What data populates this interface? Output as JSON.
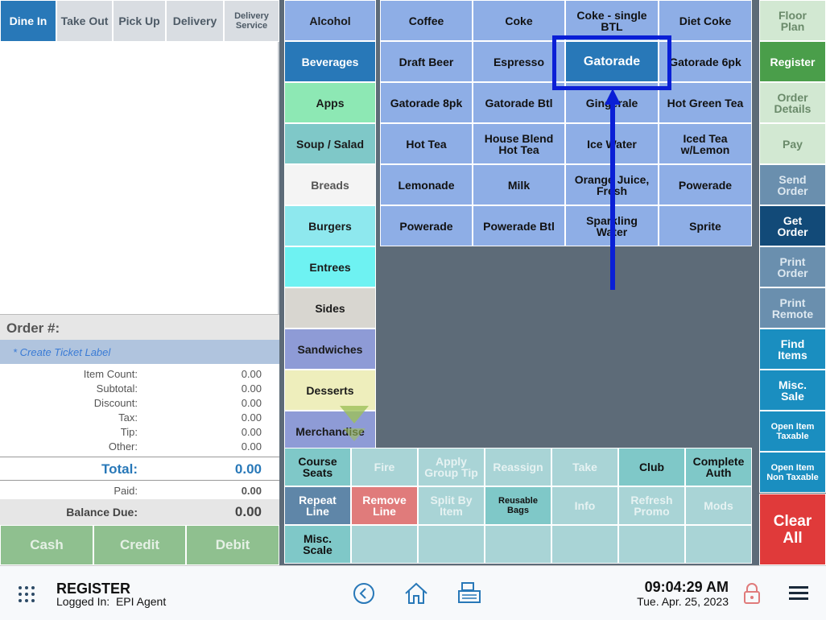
{
  "order_types": [
    {
      "label": "Dine In",
      "active": true
    },
    {
      "label": "Take Out",
      "active": false
    },
    {
      "label": "Pick Up",
      "active": false
    },
    {
      "label": "Delivery",
      "active": false
    },
    {
      "label": "Delivery Service",
      "active": false
    }
  ],
  "order": {
    "order_label": "Order #:",
    "create_ticket_label": "* Create Ticket Label",
    "totals": [
      {
        "label": "Item Count:",
        "value": "0.00"
      },
      {
        "label": "Subtotal:",
        "value": "0.00"
      },
      {
        "label": "Discount:",
        "value": "0.00"
      },
      {
        "label": "Tax:",
        "value": "0.00"
      },
      {
        "label": "Tip:",
        "value": "0.00"
      },
      {
        "label": "Other:",
        "value": "0.00"
      }
    ],
    "total_label": "Total:",
    "total_value": "0.00",
    "paid_label": "Paid:",
    "paid_value": "0.00",
    "balance_label": "Balance Due:",
    "balance_value": "0.00"
  },
  "payment_buttons": [
    "Cash",
    "Credit",
    "Debit"
  ],
  "categories": [
    {
      "label": "Alcohol",
      "color": "#8eaee6"
    },
    {
      "label": "Beverages",
      "color": "#2878b8",
      "selected": true
    },
    {
      "label": "Apps",
      "color": "#8de8b4"
    },
    {
      "label": "Soup / Salad",
      "color": "#7fc8c8"
    },
    {
      "label": "Breads",
      "color": "#f4f4f4"
    },
    {
      "label": "Burgers",
      "color": "#8ee8ee"
    },
    {
      "label": "Entrees",
      "color": "#6ef2f2"
    },
    {
      "label": "Sides",
      "color": "#d8d6d0"
    },
    {
      "label": "Sandwiches",
      "color": "#8e9bd6"
    },
    {
      "label": "Desserts",
      "color": "#eeeebc"
    },
    {
      "label": "Merchandise",
      "color": "#8e9bd6"
    }
  ],
  "items": [
    [
      "Coffee",
      "Coke",
      "Coke - single BTL",
      "Diet Coke"
    ],
    [
      "Draft Beer",
      "Espresso",
      "Gatorade",
      "Gatorade 6pk"
    ],
    [
      "Gatorade 8pk",
      "Gatorade Btl",
      "Gingerale",
      "Hot Green Tea"
    ],
    [
      "Hot Tea",
      "House Blend Hot Tea",
      "Ice Water",
      "Iced Tea w/Lemon"
    ],
    [
      "Lemonade",
      "Milk",
      "Orange Juice, Fresh",
      "Powerade"
    ],
    [
      "Powerade",
      "Powerade Btl",
      "Sparkling Water",
      "Sprite"
    ]
  ],
  "highlighted_item": "Gatorade",
  "functions": [
    [
      {
        "label": "Course Seats",
        "style": "teal"
      },
      {
        "label": "Fire",
        "style": "dim"
      },
      {
        "label": "Apply Group Tip",
        "style": "dim"
      },
      {
        "label": "Reassign",
        "style": "dim"
      },
      {
        "label": "Take",
        "style": "dim"
      },
      {
        "label": "Club",
        "style": "teal"
      },
      {
        "label": "Complete Auth",
        "style": "teal"
      }
    ],
    [
      {
        "label": "Repeat Line",
        "style": "slate"
      },
      {
        "label": "Remove Line",
        "style": "red"
      },
      {
        "label": "Split By Item",
        "style": "dim"
      },
      {
        "label": "Reusable Bags",
        "style": "teal",
        "small": true
      },
      {
        "label": "Info",
        "style": "dim"
      },
      {
        "label": "Refresh Promo",
        "style": "dim"
      },
      {
        "label": "Mods",
        "style": "dim"
      }
    ],
    [
      {
        "label": "Misc. Scale",
        "style": "teal"
      },
      {
        "label": "",
        "style": "dim"
      },
      {
        "label": "",
        "style": "dim"
      },
      {
        "label": "",
        "style": "dim"
      },
      {
        "label": "",
        "style": "dim"
      },
      {
        "label": "",
        "style": "dim"
      },
      {
        "label": "",
        "style": "dim"
      }
    ]
  ],
  "right_buttons": [
    {
      "label": "Floor Plan",
      "bg": "#d2e8d2",
      "fg": "#6a8a6a"
    },
    {
      "label": "Register",
      "bg": "#4a9e4a",
      "fg": "#ffffff"
    },
    {
      "label": "Order Details",
      "bg": "#d2e8d2",
      "fg": "#6a8a6a"
    },
    {
      "label": "Pay",
      "bg": "#d2e8d2",
      "fg": "#6a8a6a"
    },
    {
      "label": "Send Order",
      "bg": "#6a8fae",
      "fg": "#dde8f0"
    },
    {
      "label": "Get Order",
      "bg": "#124a78",
      "fg": "#ffffff"
    },
    {
      "label": "Print Order",
      "bg": "#6a8fae",
      "fg": "#dde8f0"
    },
    {
      "label": "Print Remote",
      "bg": "#6a8fae",
      "fg": "#dde8f0"
    },
    {
      "label": "Find Items",
      "bg": "#1a8ec0",
      "fg": "#ffffff"
    },
    {
      "label": "Misc. Sale",
      "bg": "#1a8ec0",
      "fg": "#ffffff"
    },
    {
      "label": "Open Item Taxable",
      "bg": "#1a8ec0",
      "fg": "#ffffff",
      "small": true
    },
    {
      "label": "Open Item Non Taxable",
      "bg": "#1a8ec0",
      "fg": "#ffffff",
      "small": true
    }
  ],
  "clear_all": "Clear All",
  "footer": {
    "title": "REGISTER",
    "logged_in": "Logged In:  EPI Agent",
    "time": "09:04:29 AM",
    "date": "Tue. Apr. 25, 2023"
  },
  "colors": {
    "accent": "#2878b8",
    "annotation": "#0a1fd6"
  }
}
